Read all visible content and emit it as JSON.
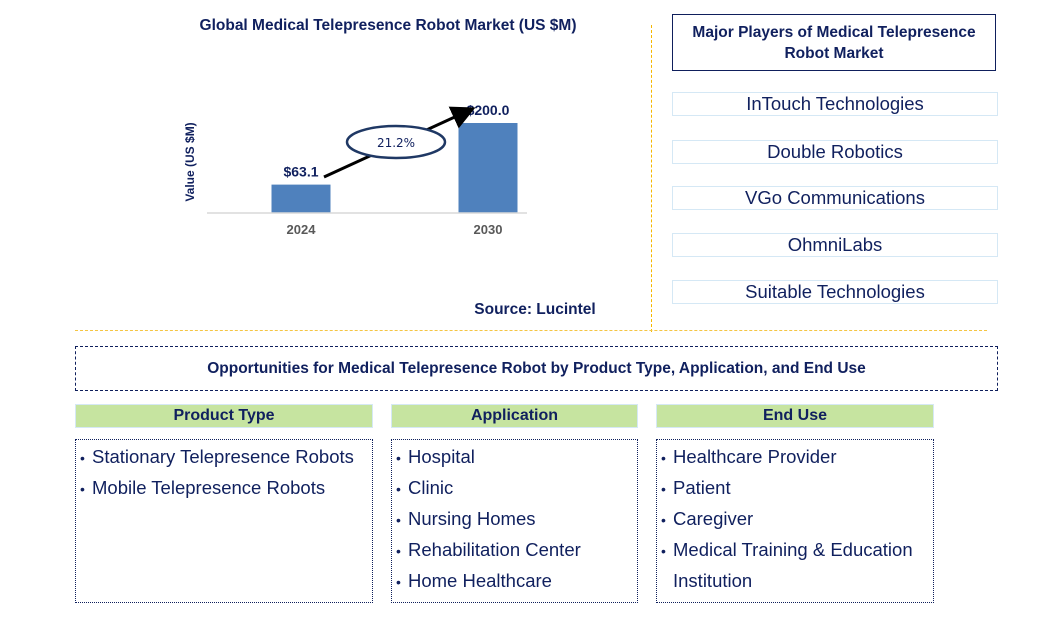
{
  "chart_data": {
    "type": "bar",
    "title": "Global Medical Telepresence Robot Market (US $M)",
    "xlabel": "",
    "ylabel": "Value (US $M)",
    "categories": [
      "2024",
      "2030"
    ],
    "values": [
      63.1,
      200.0
    ],
    "data_labels": [
      "$63.1",
      "$200.0"
    ],
    "ylim": [
      0,
      220
    ],
    "grid": false,
    "legend": "none",
    "bar_color": "#4f81bd",
    "annotations": [
      {
        "type": "growth-arrow",
        "label": "21.2%",
        "meaning": "CAGR 2024-2030"
      }
    ],
    "source": "Source: Lucintel"
  },
  "players": {
    "title": "Major Players of Medical Telepresence Robot Market",
    "items": [
      "InTouch Technologies",
      "Double Robotics",
      "VGo Communications",
      "OhmniLabs",
      "Suitable Technologies"
    ]
  },
  "opportunities": {
    "title": "Opportunities for Medical Telepresence Robot by Product Type, Application, and End Use",
    "segments": [
      {
        "heading": "Product Type",
        "items": [
          "Stationary Telepresence Robots",
          "Mobile Telepresence Robots"
        ]
      },
      {
        "heading": "Application",
        "items": [
          "Hospital",
          "Clinic",
          "Nursing Homes",
          "Rehabilitation Center",
          "Home Healthcare"
        ]
      },
      {
        "heading": "End Use",
        "items": [
          "Healthcare Provider",
          "Patient",
          "Caregiver",
          "Medical Training & Education Institution"
        ]
      }
    ]
  },
  "colors": {
    "text_navy": "#10205e",
    "accent_gold": "#f5b800",
    "segment_header_green": "#c6e4a0",
    "player_border": "#d5e8f5"
  }
}
